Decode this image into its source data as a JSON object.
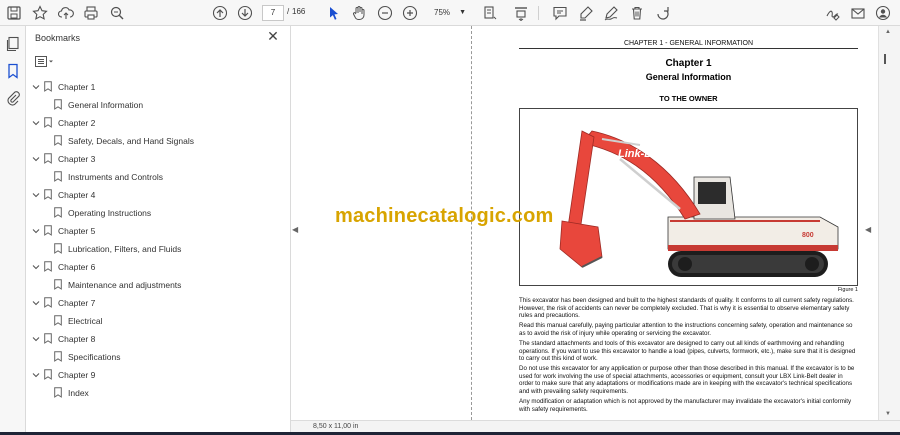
{
  "toolbar": {
    "page_current": "7",
    "page_separator": "/",
    "page_total": "166",
    "zoom": "75%",
    "icons": [
      "save-icon",
      "bookmark-star-icon",
      "upload-cloud-icon",
      "print-icon",
      "zoom-search-icon",
      "page-up-icon",
      "page-down-icon",
      "select-cursor-icon",
      "hand-tool-icon",
      "zoom-out-icon",
      "zoom-in-icon",
      "fit-page-icon",
      "scroll-mode-icon",
      "comment-icon",
      "highlight-pen-icon",
      "draw-icon",
      "delete-icon",
      "rotate-icon",
      "sign-icon",
      "email-icon",
      "account-icon"
    ]
  },
  "bookmarks": {
    "title": "Bookmarks",
    "items": [
      {
        "chapter": "Chapter 1",
        "child": "General Information"
      },
      {
        "chapter": "Chapter 2",
        "child": "Safety, Decals, and Hand Signals"
      },
      {
        "chapter": "Chapter 3",
        "child": "Instruments and Controls"
      },
      {
        "chapter": "Chapter 4",
        "child": "Operating Instructions"
      },
      {
        "chapter": "Chapter 5",
        "child": "Lubrication, Filters, and Fluids"
      },
      {
        "chapter": "Chapter 6",
        "child": "Maintenance and adjustments"
      },
      {
        "chapter": "Chapter 7",
        "child": "Electrical"
      },
      {
        "chapter": "Chapter 8",
        "child": "Specifications"
      },
      {
        "chapter": "Chapter 9",
        "child": "Index"
      }
    ]
  },
  "document": {
    "header": "CHAPTER 1 - GENERAL INFORMATION",
    "chapter_title": "Chapter 1",
    "chapter_subtitle": "General Information",
    "section_title": "TO THE OWNER",
    "figure_brand": "Link-Belt",
    "figure_model": "800",
    "figure_caption": "Figure 1",
    "paragraphs": [
      "This excavator has been designed and built to the highest standards of quality. It conforms to all current safety regulations. However, the risk of accidents can never be completely excluded. That is why it is essential to observe elementary safety rules and precautions.",
      "Read this manual carefully, paying particular attention to the instructions concerning safety, operation and maintenance so as to avoid the risk of injury while operating or servicing the excavator.",
      "The standard attachments and tools of this excavator are designed to carry out all kinds of earthmoving and rehandling operations. If you want to use this excavator to handle a load (pipes, culverts, formwork, etc.), make sure that it is designed to carry out this kind of work.",
      "Do not use this excavator for any application or purpose other than those described in this manual. If the excavator is to be used for work involving the use of special attachments, accessories or equipment, consult your LBX Link-Belt dealer in order to make sure that any adaptations or modifications made are in keeping with the excavator's technical specifications and with prevailing safety requirements.",
      "Any modification or adaptation which is not approved by the manufacturer may invalidate the excavator's initial conformity with safety requirements."
    ],
    "watermark": "machinecatalogic.com"
  },
  "status": {
    "page_size": "8,50 x 11,00 in"
  },
  "colors": {
    "accent": "#1b4fd1",
    "excavator_red": "#e8473c",
    "watermark": "#d8a400"
  }
}
